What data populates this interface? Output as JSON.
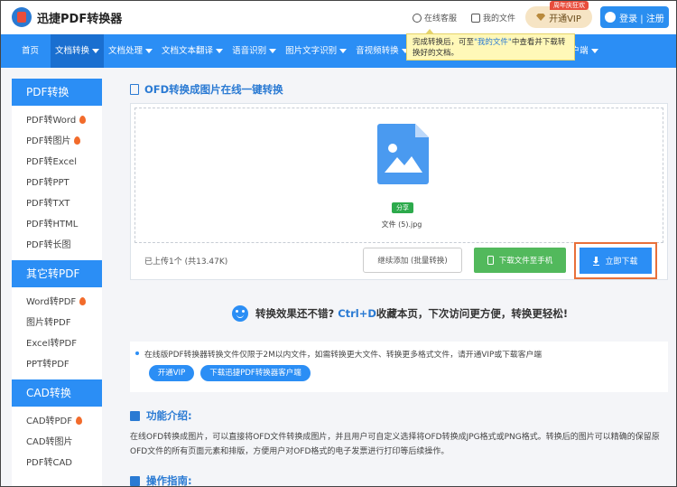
{
  "header": {
    "brand": "迅捷PDF转换器",
    "online_service": "在线客服",
    "my_files": "我的文件",
    "vip_label": "开通VIP",
    "vip_tag": "周年庆狂欢",
    "login_label": "登录 | 注册"
  },
  "nav": {
    "items": [
      {
        "label": "首页",
        "dropdown": false
      },
      {
        "label": "文档转换",
        "dropdown": true
      },
      {
        "label": "文档处理",
        "dropdown": true
      },
      {
        "label": "文档文本翻译",
        "dropdown": true
      },
      {
        "label": "语音识别",
        "dropdown": true
      },
      {
        "label": "图片文字识别",
        "dropdown": true
      },
      {
        "label": "音视频转换",
        "dropdown": true
      }
    ],
    "trailing_label": "户端"
  },
  "tooltip": {
    "prefix": "完成转换后，可至",
    "link": "\"我的文件\"",
    "suffix": "中查看并下载转换好的文档。"
  },
  "sidebar": {
    "groups": [
      {
        "title": "PDF转换",
        "items": [
          {
            "label": "PDF转Word",
            "hot": true
          },
          {
            "label": "PDF转图片",
            "hot": true
          },
          {
            "label": "PDF转Excel",
            "hot": false
          },
          {
            "label": "PDF转PPT",
            "hot": false
          },
          {
            "label": "PDF转TXT",
            "hot": false
          },
          {
            "label": "PDF转HTML",
            "hot": false
          },
          {
            "label": "PDF转长图",
            "hot": false
          }
        ]
      },
      {
        "title": "其它转PDF",
        "items": [
          {
            "label": "Word转PDF",
            "hot": true
          },
          {
            "label": "图片转PDF",
            "hot": false
          },
          {
            "label": "Excel转PDF",
            "hot": false
          },
          {
            "label": "PPT转PDF",
            "hot": false
          }
        ]
      },
      {
        "title": "CAD转换",
        "items": [
          {
            "label": "CAD转PDF",
            "hot": true
          },
          {
            "label": "CAD转图片",
            "hot": false
          },
          {
            "label": "PDF转CAD",
            "hot": false
          }
        ]
      }
    ]
  },
  "main": {
    "title": "OFD转换成图片在线一键转换",
    "file": {
      "share_label": "分享",
      "name": "文件 (5).jpg"
    },
    "upload_status": "已上传1个 (共13.47K)",
    "continue_label": "继续添加 (批量转换)",
    "phone_label": "下载文件至手机",
    "download_label": "立即下载",
    "bookmark": {
      "prefix": "转换效果还不错?",
      "key": "Ctrl+D",
      "suffix": "收藏本页，下次访问更方便，转换更轻松!"
    },
    "notice": "在线版PDF转换器转换文件仅限于2M以内文件，如需转换更大文件、转换更多格式文件，请开通VIP或下载客户端",
    "open_vip_label": "开通VIP",
    "download_client_label": "下载迅捷PDF转换器客户端",
    "feature_title": "功能介绍:",
    "feature_text": "在线OFD转换成图片，可以直接将OFD文件转换成图片，并且用户可自定义选择将OFD转换成JPG格式或PNG格式。转换后的图片可以精确的保留原OFD文件的所有页面元素和排版，方便用户对OFD格式的电子发票进行打印等后续操作。",
    "guide_title": "操作指南:"
  },
  "colors": {
    "primary": "#2b8ef5",
    "nav_active": "#1a6fd0",
    "green": "#52b95c",
    "highlight_border": "#e8703a",
    "hot": "#f26b2b"
  }
}
